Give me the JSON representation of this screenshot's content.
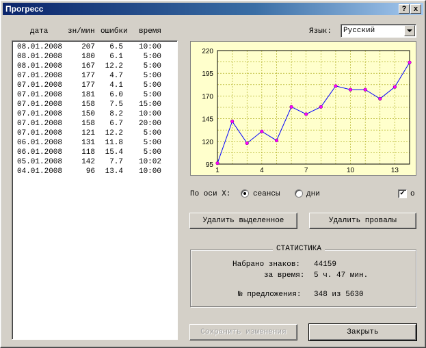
{
  "window": {
    "title": "Прогресс",
    "help_label": "?",
    "close_label": "x"
  },
  "headers": {
    "date": "дата",
    "speed": "зн/мин",
    "errors": "ошибки",
    "time": "время"
  },
  "rows": [
    [
      "08.01.2008",
      "207",
      "6.5",
      "10:00"
    ],
    [
      "08.01.2008",
      "180",
      "6.1",
      "5:00"
    ],
    [
      "08.01.2008",
      "167",
      "12.2",
      "5:00"
    ],
    [
      "07.01.2008",
      "177",
      "4.7",
      "5:00"
    ],
    [
      "07.01.2008",
      "177",
      "4.1",
      "5:00"
    ],
    [
      "07.01.2008",
      "181",
      "6.0",
      "5:00"
    ],
    [
      "07.01.2008",
      "158",
      "7.5",
      "15:00"
    ],
    [
      "07.01.2008",
      "150",
      "8.2",
      "10:00"
    ],
    [
      "07.01.2008",
      "158",
      "6.7",
      "20:00"
    ],
    [
      "07.01.2008",
      "121",
      "12.2",
      "5:00"
    ],
    [
      "06.01.2008",
      "131",
      "11.8",
      "5:00"
    ],
    [
      "06.01.2008",
      "118",
      "15.4",
      "5:00"
    ],
    [
      "05.01.2008",
      "142",
      "7.7",
      "10:02"
    ],
    [
      "04.01.2008",
      "96",
      "13.4",
      "10:00"
    ]
  ],
  "language": {
    "label": "Язык:",
    "value": "Русский"
  },
  "chart_data": {
    "type": "line",
    "x": [
      1,
      2,
      3,
      4,
      5,
      6,
      7,
      8,
      9,
      10,
      11,
      12,
      13,
      14
    ],
    "values": [
      96,
      142,
      118,
      131,
      121,
      158,
      150,
      158,
      181,
      177,
      177,
      167,
      180,
      207
    ],
    "xticks": [
      1,
      4,
      7,
      10,
      13
    ],
    "yticks": [
      95,
      120,
      145,
      170,
      195,
      220
    ],
    "xlim": [
      1,
      14
    ],
    "ylim": [
      95,
      220
    ],
    "grid": true,
    "line_color": "#0000ff",
    "marker_color": "#ff00ff",
    "background": "#ffffcc"
  },
  "axis_control": {
    "label": "По оси X:",
    "opt_sessions": "сеансы",
    "opt_days": "дни",
    "selected": "сеансы",
    "checkbox_label": "о",
    "checkbox_checked": true,
    "check_glyph": "✔"
  },
  "buttons": {
    "delete_selected": "Удалить выделенное",
    "delete_failures": "Удалить провалы",
    "save": "Сохранить изменения",
    "close": "Закрыть"
  },
  "stats": {
    "title": "СТАТИСТИКА",
    "typed_label": "Набрано знаков:",
    "typed_value": "44159",
    "time_label": "за время:",
    "time_value": "5 ч. 47 мин.",
    "sentence_label": "№ предложения:",
    "sentence_value": "348 из 5630"
  }
}
